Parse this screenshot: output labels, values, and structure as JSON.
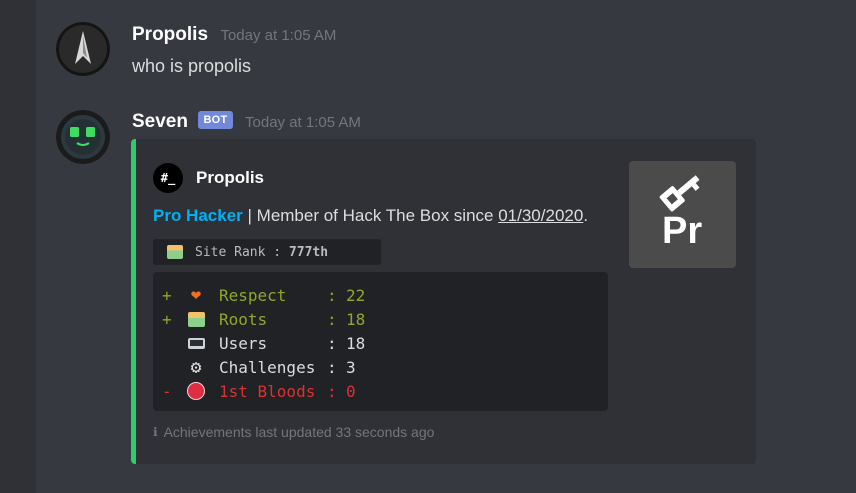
{
  "messages": [
    {
      "username": "Propolis",
      "timestamp": "Today at 1:05 AM",
      "text": "who is propolis"
    },
    {
      "username": "Seven",
      "badge": "BOT",
      "timestamp": "Today at 1:05 AM"
    }
  ],
  "embed": {
    "accent_color": "#2ecc71",
    "author": {
      "icon_text": "#_",
      "name": "Propolis"
    },
    "description": {
      "rank_link": "Pro Hacker",
      "separator": " | ",
      "text": "Member of Hack The Box since ",
      "date": "01/30/2020",
      "period": "."
    },
    "site_rank": {
      "icon": "hacker-emoji-icon",
      "label": "Site Rank : ",
      "value": "777th"
    },
    "stats": [
      {
        "prefix": "+",
        "icon": "heart-icon",
        "label": "Respect",
        "colon": ":",
        "value": "22",
        "color": "green"
      },
      {
        "prefix": "+",
        "icon": "hacker-emoji-icon",
        "label": "Roots",
        "colon": ":",
        "value": "18",
        "color": "green"
      },
      {
        "prefix": "",
        "icon": "laptop-icon",
        "label": "Users",
        "colon": ":",
        "value": "18",
        "color": "plain"
      },
      {
        "prefix": "",
        "icon": "gear-icon",
        "label": "Challenges",
        "colon": ":",
        "value": "3",
        "color": "plain"
      },
      {
        "prefix": "-",
        "icon": "red-circle-icon",
        "label": "1st Bloods",
        "colon": ":",
        "value": "0",
        "color": "red"
      }
    ],
    "footer": {
      "icon": "info-icon",
      "text": "Achievements last updated 33 seconds ago"
    },
    "thumbnail": {
      "text": "Pr",
      "icon": "key-icon"
    }
  }
}
